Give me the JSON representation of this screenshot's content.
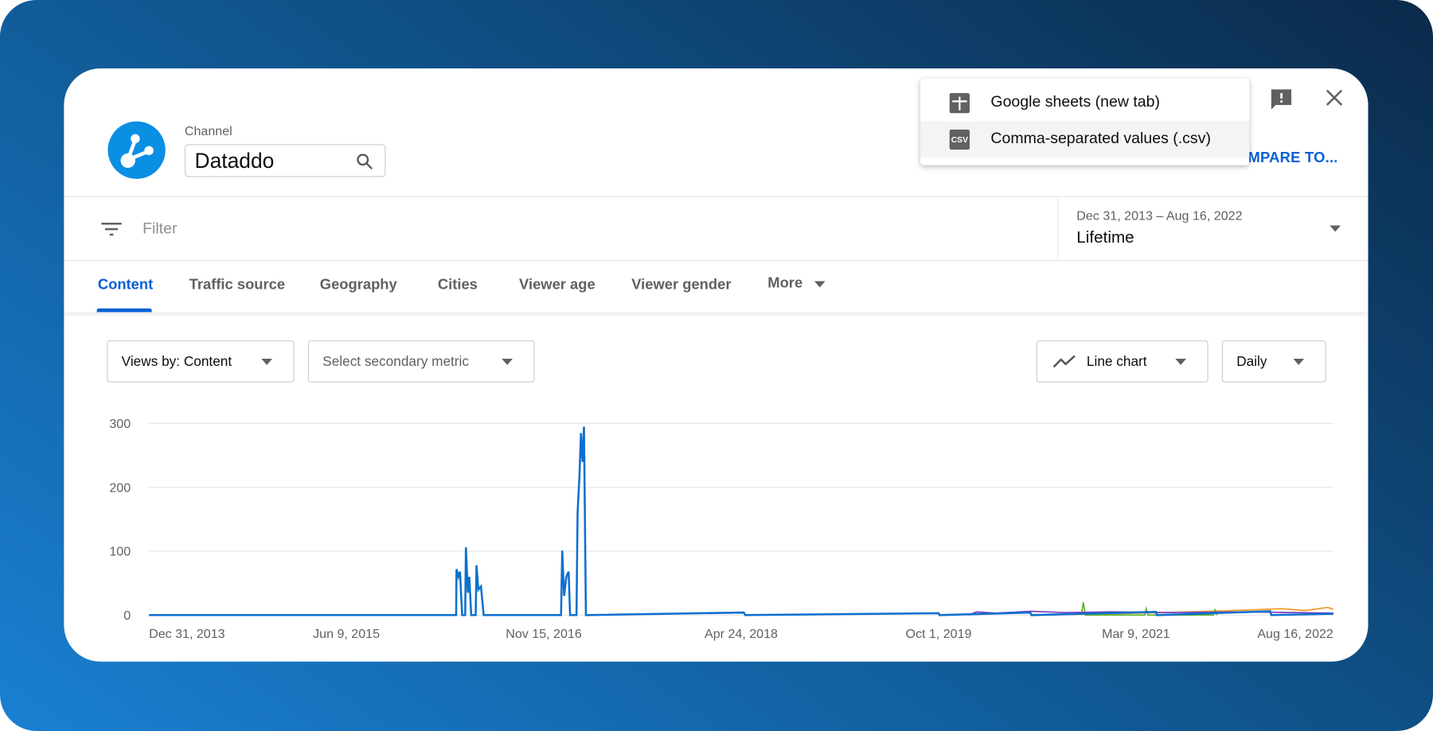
{
  "header": {
    "channel_label": "Channel",
    "channel_value": "Dataddo",
    "compare_label": "COMPARE TO..."
  },
  "export_menu": {
    "items": [
      {
        "label": "Google sheets (new tab)",
        "icon": "sheets-icon"
      },
      {
        "label": "Comma-separated values (.csv)",
        "icon": "csv-icon",
        "icon_text": "CSV"
      }
    ]
  },
  "filter": {
    "placeholder": "Filter"
  },
  "date": {
    "range": "Dec 31, 2013 – Aug 16, 2022",
    "preset": "Lifetime"
  },
  "tabs": [
    {
      "label": "Content",
      "active": true
    },
    {
      "label": "Traffic source"
    },
    {
      "label": "Geography"
    },
    {
      "label": "Cities"
    },
    {
      "label": "Viewer age"
    },
    {
      "label": "Viewer gender"
    },
    {
      "label": "More"
    }
  ],
  "controls": {
    "primary": "Views by: Content",
    "secondary": "Select secondary metric",
    "chart_type": "Line chart",
    "interval": "Daily"
  },
  "colors": {
    "accent": "#065fd4",
    "logo": "#0a8fe3",
    "series_main": "#0b6fcf"
  },
  "chart_data": {
    "type": "line",
    "ylim": [
      0,
      300
    ],
    "yticks": [
      "0",
      "100",
      "200",
      "300"
    ],
    "xlim": [
      "2013-12-31",
      "2022-08-16"
    ],
    "xticks": [
      "Dec 31, 2013",
      "Jun 9, 2015",
      "Nov 15, 2016",
      "Apr 24, 2018",
      "Oct 1, 2019",
      "Mar 9, 2021",
      "Aug 16, 2022"
    ],
    "grid": true,
    "series": [
      {
        "color": "#0b6fcf",
        "points": [
          [
            "2013-12-31",
            0
          ],
          [
            "2016-03-27",
            0
          ],
          [
            "2016-03-28",
            72
          ],
          [
            "2016-04-02",
            60
          ],
          [
            "2016-04-06",
            68
          ],
          [
            "2016-04-12",
            0
          ],
          [
            "2016-04-20",
            0
          ],
          [
            "2016-04-22",
            106
          ],
          [
            "2016-04-27",
            35
          ],
          [
            "2016-05-01",
            60
          ],
          [
            "2016-05-06",
            0
          ],
          [
            "2016-05-18",
            0
          ],
          [
            "2016-05-20",
            78
          ],
          [
            "2016-05-25",
            40
          ],
          [
            "2016-06-01",
            45
          ],
          [
            "2016-06-08",
            0
          ],
          [
            "2016-12-31",
            0
          ],
          [
            "2017-01-03",
            101
          ],
          [
            "2017-01-08",
            30
          ],
          [
            "2017-01-14",
            60
          ],
          [
            "2017-01-20",
            68
          ],
          [
            "2017-01-24",
            0
          ],
          [
            "2017-02-10",
            0
          ],
          [
            "2017-02-13",
            160
          ],
          [
            "2017-02-18",
            220
          ],
          [
            "2017-02-22",
            285
          ],
          [
            "2017-02-26",
            240
          ],
          [
            "2017-03-02",
            295
          ],
          [
            "2017-03-07",
            0
          ],
          [
            "2018-05-01",
            4
          ],
          [
            "2018-05-05",
            0
          ],
          [
            "2019-10-01",
            3
          ],
          [
            "2019-10-04",
            0
          ],
          [
            "2020-06-01",
            4
          ],
          [
            "2020-06-04",
            0
          ],
          [
            "2021-05-01",
            5
          ],
          [
            "2021-05-04",
            0
          ],
          [
            "2022-03-01",
            6
          ],
          [
            "2022-03-04",
            0
          ],
          [
            "2022-08-16",
            2
          ]
        ]
      },
      {
        "color": "#7b3fc4",
        "points": [
          [
            "2019-12-20",
            0
          ],
          [
            "2020-01-10",
            5
          ],
          [
            "2020-03-01",
            3
          ],
          [
            "2020-06-01",
            6
          ],
          [
            "2020-09-01",
            4
          ],
          [
            "2021-01-01",
            5
          ],
          [
            "2021-06-01",
            4
          ],
          [
            "2022-01-01",
            5
          ],
          [
            "2022-08-16",
            3
          ]
        ]
      },
      {
        "color": "#5bb531",
        "points": [
          [
            "2020-10-15",
            0
          ],
          [
            "2020-10-20",
            20
          ],
          [
            "2020-10-25",
            0
          ],
          [
            "2021-04-01",
            0
          ],
          [
            "2021-04-05",
            10
          ],
          [
            "2021-04-10",
            0
          ],
          [
            "2021-10-01",
            0
          ],
          [
            "2021-10-05",
            8
          ],
          [
            "2021-10-10",
            0
          ]
        ]
      },
      {
        "color": "#f09a2b",
        "points": [
          [
            "2020-06-01",
            0
          ],
          [
            "2021-01-01",
            2
          ],
          [
            "2021-08-01",
            5
          ],
          [
            "2022-01-01",
            8
          ],
          [
            "2022-04-01",
            10
          ],
          [
            "2022-06-01",
            7
          ],
          [
            "2022-08-01",
            12
          ],
          [
            "2022-08-16",
            9
          ]
        ]
      }
    ]
  }
}
